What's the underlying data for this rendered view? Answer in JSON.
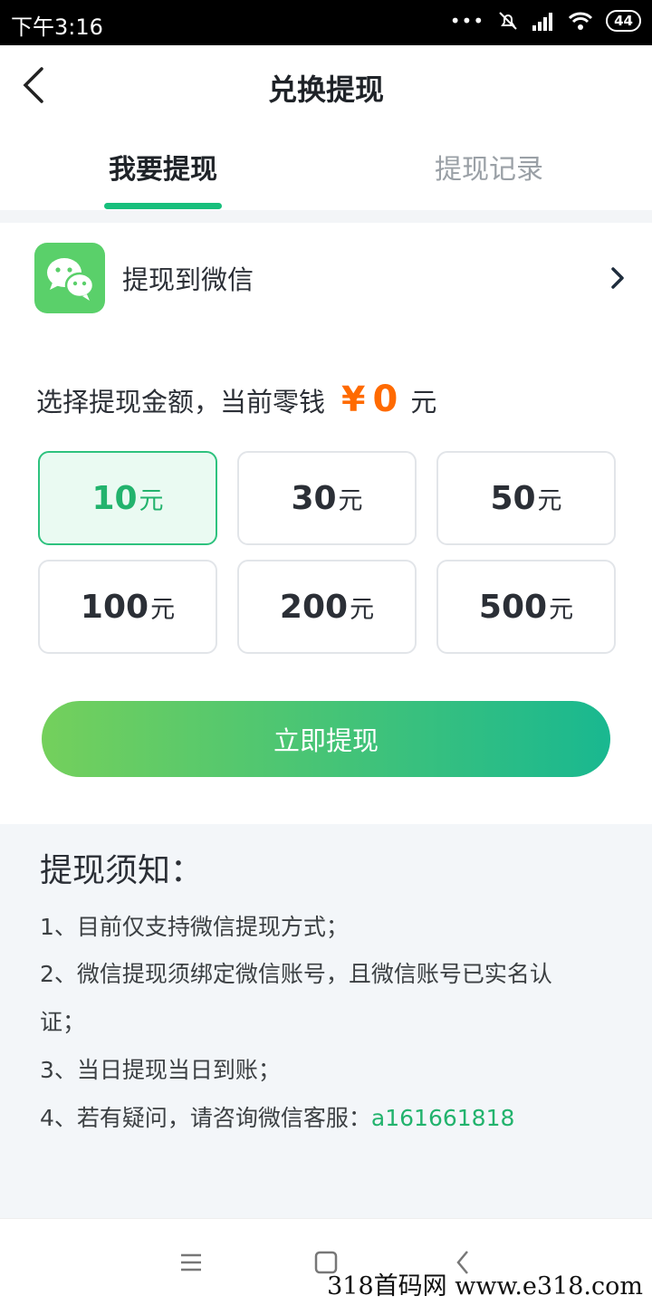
{
  "status_bar": {
    "time": "下午3:16",
    "dots": "•••",
    "battery": "44"
  },
  "header": {
    "title": "兑换提现"
  },
  "tabs": [
    {
      "label": "我要提现",
      "active": true
    },
    {
      "label": "提现记录",
      "active": false
    }
  ],
  "withdraw_target": {
    "label": "提现到微信",
    "icon": "wechat-icon",
    "icon_color": "#5ad06a"
  },
  "amount": {
    "prompt": "选择提现金额，当前零钱",
    "currency_symbol": "¥",
    "balance": "0",
    "unit": "元"
  },
  "options": [
    {
      "value": "10",
      "unit": "元",
      "selected": true
    },
    {
      "value": "30",
      "unit": "元",
      "selected": false
    },
    {
      "value": "50",
      "unit": "元",
      "selected": false
    },
    {
      "value": "100",
      "unit": "元",
      "selected": false
    },
    {
      "value": "200",
      "unit": "元",
      "selected": false
    },
    {
      "value": "500",
      "unit": "元",
      "selected": false
    }
  ],
  "cta": {
    "label": "立即提现"
  },
  "notice": {
    "title": "提现须知：",
    "line1": "1、目前仅支持微信提现方式；",
    "line2a": "2、微信提现须绑定微信账号，且微信账号已实名认",
    "line2b": "证；",
    "line3": "3、当日提现当日到账；",
    "line4_prefix": "4、若有疑问，请咨询微信客服：",
    "line4_id": "a161661818"
  },
  "watermark": "318首码网  www.e318.com",
  "colors": {
    "accent": "#17bf7c",
    "balance": "#ff6a00"
  }
}
